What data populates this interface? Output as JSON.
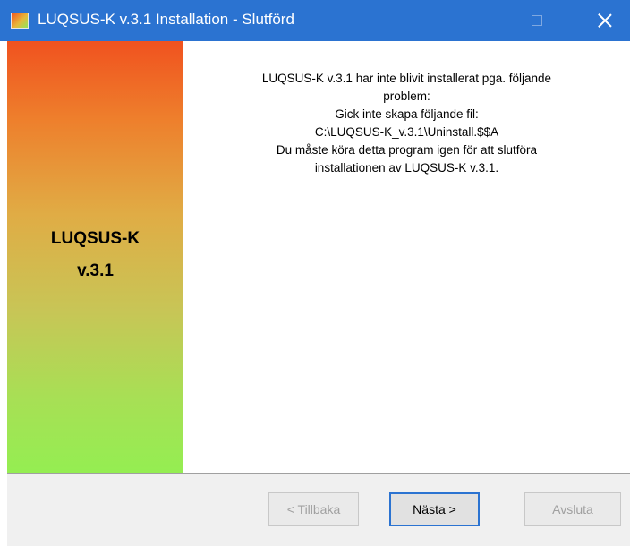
{
  "window": {
    "title": "LUQSUS-K v.3.1 Installation - Slutförd",
    "accent_color": "#2b73d1"
  },
  "banner": {
    "line1": "LUQSUS-K",
    "line2": "v.3.1"
  },
  "message": {
    "lines": [
      "LUQSUS-K v.3.1 har inte blivit installerat pga. följande",
      "problem:",
      "Gick inte skapa följande fil:",
      "C:\\LUQSUS-K_v.3.1\\Uninstall.$$A",
      "Du måste köra detta program igen för att slutföra",
      "installationen av LUQSUS-K v.3.1."
    ]
  },
  "buttons": {
    "back_label": "< Tillbaka",
    "next_label": "Nästa >",
    "cancel_label": "Avsluta"
  }
}
